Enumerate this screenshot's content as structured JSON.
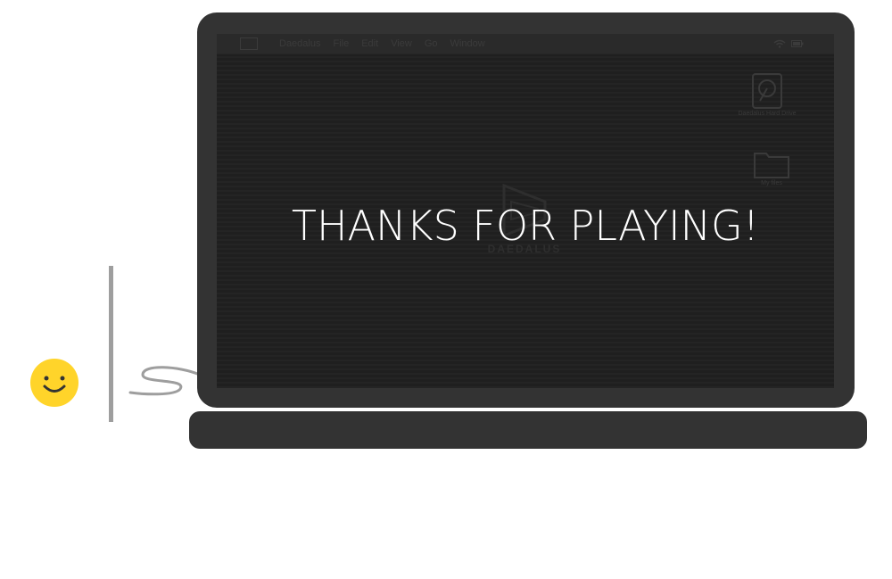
{
  "game": {
    "message": "THANKS FOR PLAYING!",
    "colors": {
      "laptop": "#333333",
      "screen": "#1f1f1f",
      "smiley": "#FFD42A",
      "bar": "#9e9e9e"
    }
  },
  "menubar": {
    "items": [
      "Daedalus",
      "File",
      "Edit",
      "View",
      "Go",
      "Window"
    ]
  },
  "desktop": {
    "hard_drive_label": "Daedalus Hard Drive",
    "folder_label": "My files",
    "watermark": "DAEDALUS"
  }
}
